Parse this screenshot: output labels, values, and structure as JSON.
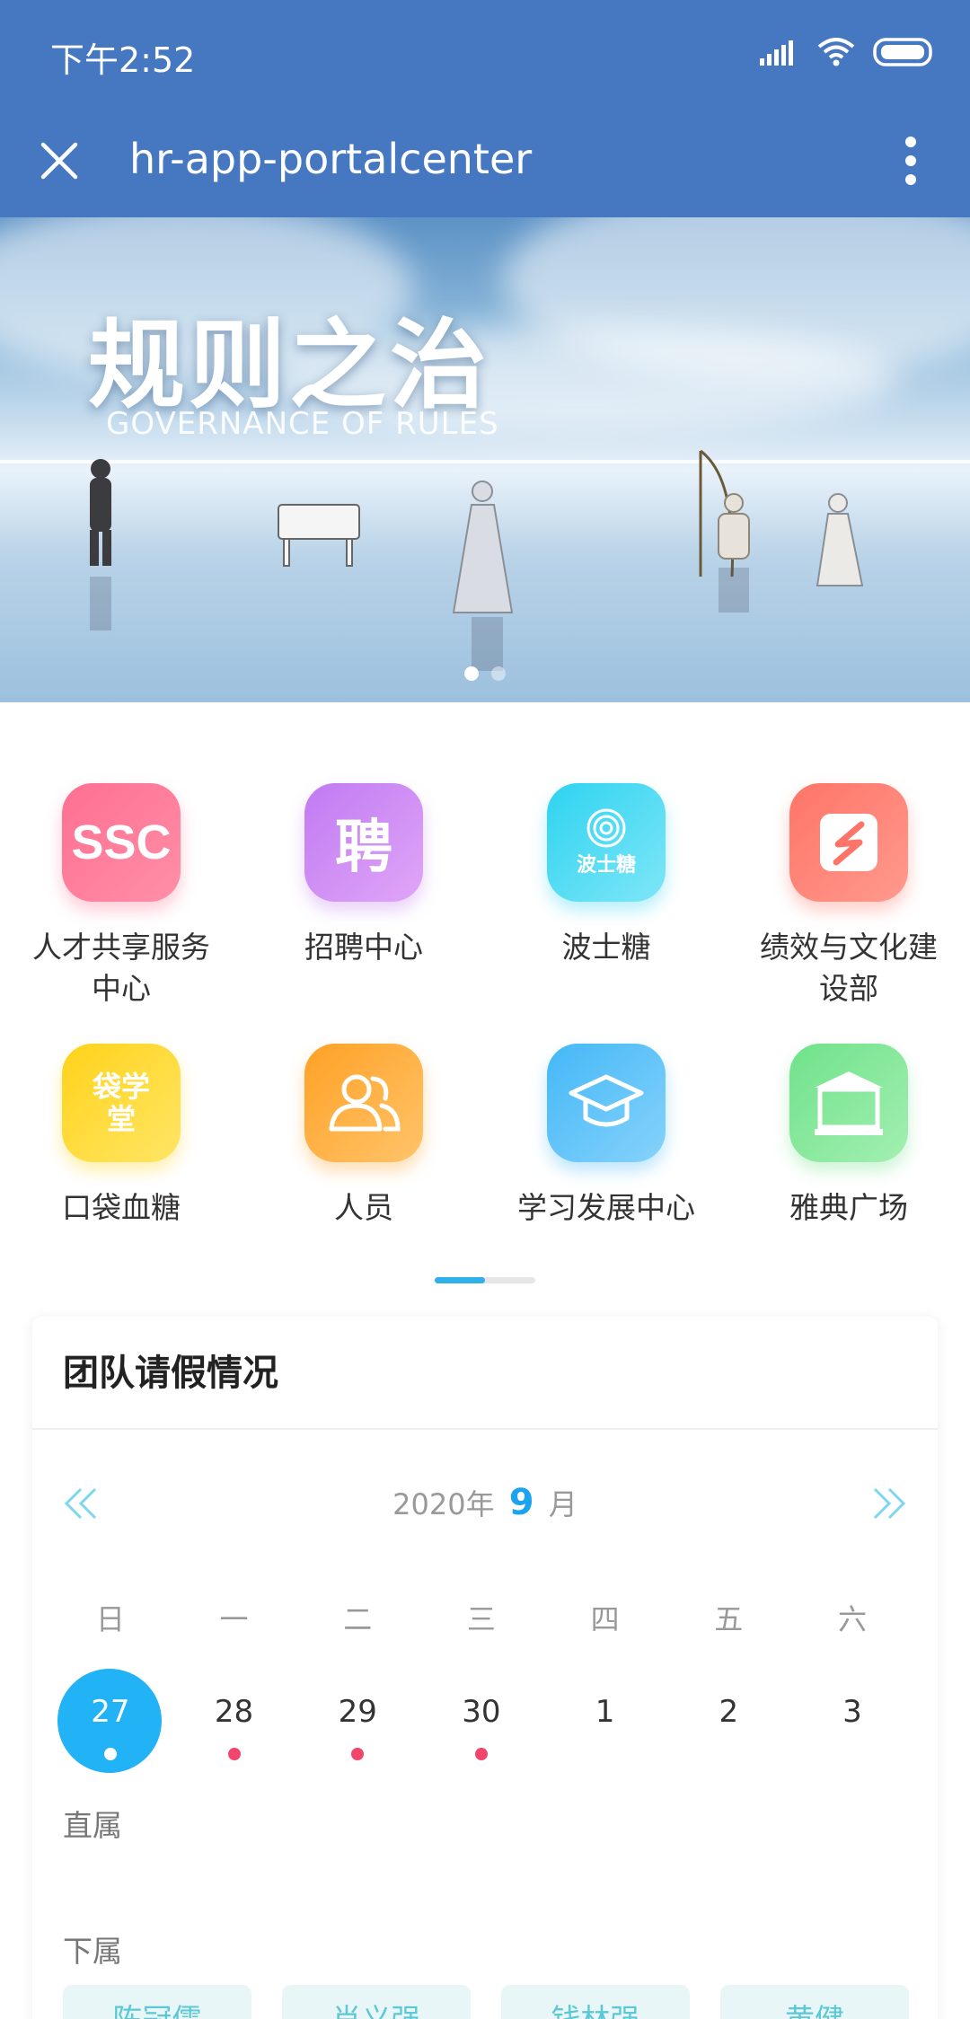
{
  "status_bar": {
    "time": "下午2:52",
    "icons": [
      "signal-icon",
      "wifi-icon",
      "battery-icon"
    ]
  },
  "app_bar": {
    "title": "hr-app-portalcenter",
    "close_icon": "close-icon",
    "more_icon": "more-vertical-icon"
  },
  "banner": {
    "title": "规则之治",
    "subtitle": "GOVERNANCE OF RULES",
    "slide_count": 2,
    "active_slide": 1
  },
  "apps": [
    {
      "label": "人才共享服务中心",
      "icon": "ssc-icon",
      "icon_text": "SSC",
      "color_from": "#ff6f91",
      "color_to": "#ff8fa8"
    },
    {
      "label": "招聘中心",
      "icon": "recruit-icon",
      "icon_text": "聘",
      "color_from": "#c07af2",
      "color_to": "#e0a6f7"
    },
    {
      "label": "波士糖",
      "icon": "spiral-candy-icon",
      "icon_text": "波士糖",
      "color_from": "#2ed3f0",
      "color_to": "#7fe6f8"
    },
    {
      "label": "绩效与文化建设部",
      "icon": "performance-icon",
      "icon_text": "",
      "color_from": "#ff7468",
      "color_to": "#ff9a8d"
    },
    {
      "label": "口袋血糖",
      "icon": "pocket-school-icon",
      "icon_text": "袋学堂",
      "color_from": "#ffd31a",
      "color_to": "#ffe566"
    },
    {
      "label": "人员",
      "icon": "people-icon",
      "icon_text": "",
      "color_from": "#ffa126",
      "color_to": "#ffc46a"
    },
    {
      "label": "学习发展中心",
      "icon": "graduation-cap-icon",
      "icon_text": "",
      "color_from": "#44b8f7",
      "color_to": "#86d2fb"
    },
    {
      "label": "雅典广场",
      "icon": "plaza-building-icon",
      "icon_text": "雅典广场",
      "color_from": "#6fe28a",
      "color_to": "#a3efb1"
    }
  ],
  "pager": {
    "pages": 2,
    "current": 1
  },
  "leave_card": {
    "title": "团队请假情况",
    "year_text": "2020年",
    "month": "9",
    "month_suffix": "月",
    "weekdays": [
      "日",
      "一",
      "二",
      "三",
      "四",
      "五",
      "六"
    ],
    "dates": [
      {
        "day": "27",
        "selected": true,
        "has_leave": true
      },
      {
        "day": "28",
        "selected": false,
        "has_leave": true
      },
      {
        "day": "29",
        "selected": false,
        "has_leave": true
      },
      {
        "day": "30",
        "selected": false,
        "has_leave": true
      },
      {
        "day": "1",
        "selected": false,
        "has_leave": false
      },
      {
        "day": "2",
        "selected": false,
        "has_leave": false
      },
      {
        "day": "3",
        "selected": false,
        "has_leave": false
      }
    ],
    "direct_label": "直属",
    "sub_label": "下属",
    "subordinates": [
      "陈冠儒",
      "肖义强",
      "钱林强",
      "黄健"
    ]
  },
  "colors": {
    "header": "#4677c1",
    "accent": "#22b2f6",
    "leave_dot": "#f2456b",
    "chip_bg": "#e8f6f8",
    "chip_text": "#5bc8d6"
  }
}
